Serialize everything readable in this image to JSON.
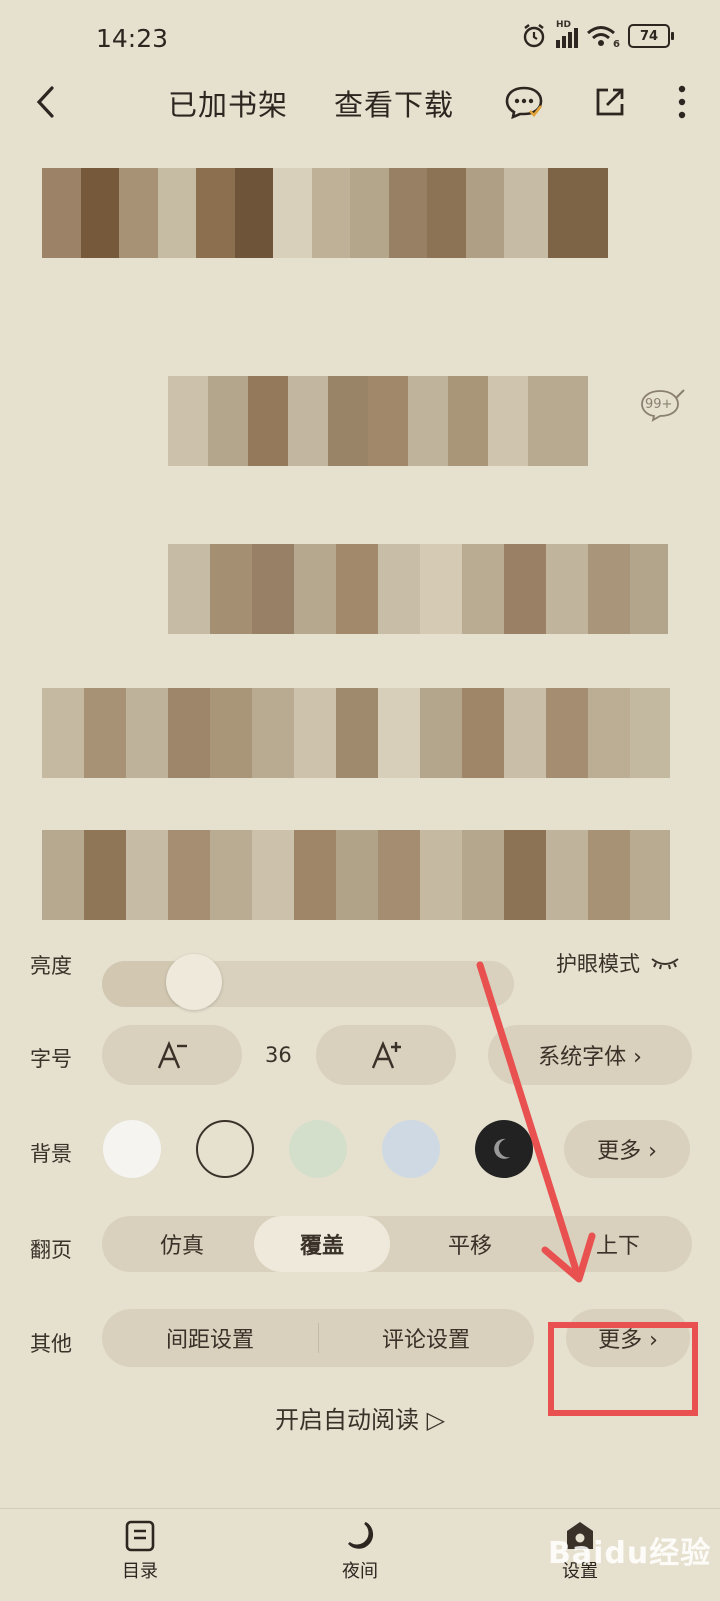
{
  "status_bar": {
    "time": "14:23",
    "network_label": "HD",
    "wifi_label": "6",
    "battery": "74"
  },
  "toolbar": {
    "added_to_shelf": "已加书架",
    "view_download": "查看下载"
  },
  "reading": {
    "comment_count": "99+"
  },
  "settings": {
    "brightness": {
      "label": "亮度",
      "level": 0.1,
      "eye_mode": "护眼模式"
    },
    "font_size": {
      "label": "字号",
      "value": "36",
      "font_family": "系统字体 ›"
    },
    "background": {
      "label": "背景",
      "swatches": [
        "#f5f4f1",
        "#e6e0cf",
        "#d4dfcb",
        "#cfd9e3",
        "#222222"
      ],
      "more": "更多 ›"
    },
    "page_turn": {
      "label": "翻页",
      "options": [
        "仿真",
        "覆盖",
        "平移",
        "上下"
      ],
      "active": "覆盖"
    },
    "other": {
      "label": "其他",
      "spacing": "间距设置",
      "comment": "评论设置",
      "more": "更多 ›"
    },
    "auto_read": "开启自动阅读 ▷"
  },
  "bottom_nav": {
    "items": [
      {
        "label": "目录"
      },
      {
        "label": "夜间"
      },
      {
        "label": "设置"
      }
    ]
  },
  "watermark": "Baidu经验",
  "colors": {
    "accent": "#2d2620",
    "annotation_red": "#e85150",
    "page_bg": "#e6e0cf"
  }
}
